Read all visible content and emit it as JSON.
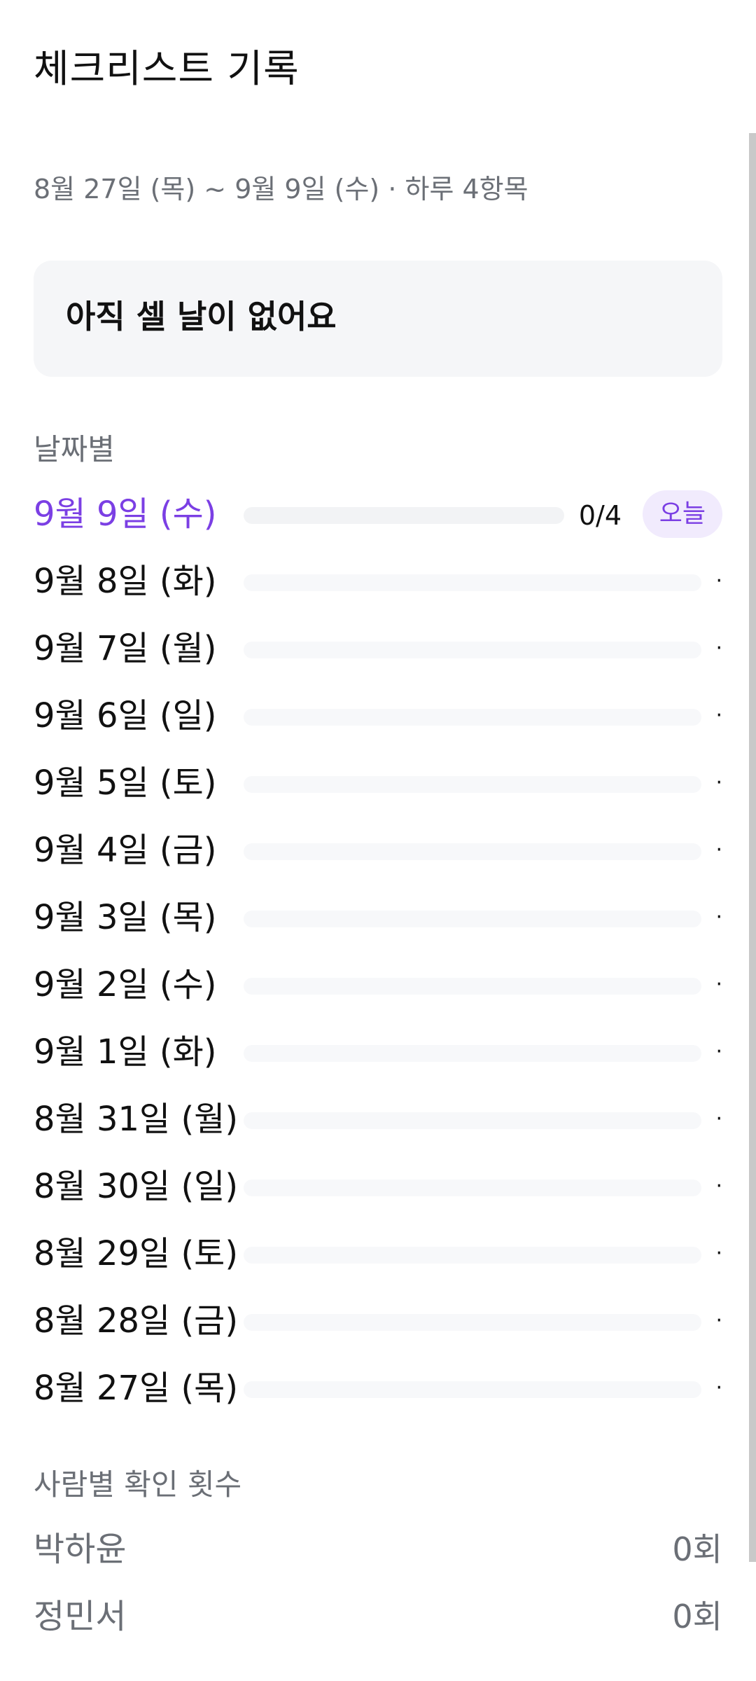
{
  "header": {
    "title": "체크리스트 기록"
  },
  "summary": "8월 27일 (목) ~ 9월 9일 (수) · 하루 4항목",
  "empty_state": {
    "message": "아직 셀 날이 없어요"
  },
  "by_date": {
    "label": "날짜별",
    "today_badge": "오늘",
    "dot_mark": "·",
    "rows": [
      {
        "label": "9월 9일 (수)",
        "today": true,
        "count": "0/4",
        "progress": 0
      },
      {
        "label": "9월 8일 (화)",
        "today": false,
        "progress": 0
      },
      {
        "label": "9월 7일 (월)",
        "today": false,
        "progress": 0
      },
      {
        "label": "9월 6일 (일)",
        "today": false,
        "progress": 0
      },
      {
        "label": "9월 5일 (토)",
        "today": false,
        "progress": 0
      },
      {
        "label": "9월 4일 (금)",
        "today": false,
        "progress": 0
      },
      {
        "label": "9월 3일 (목)",
        "today": false,
        "progress": 0
      },
      {
        "label": "9월 2일 (수)",
        "today": false,
        "progress": 0
      },
      {
        "label": "9월 1일 (화)",
        "today": false,
        "progress": 0
      },
      {
        "label": "8월 31일 (월)",
        "today": false,
        "progress": 0
      },
      {
        "label": "8월 30일 (일)",
        "today": false,
        "progress": 0
      },
      {
        "label": "8월 29일 (토)",
        "today": false,
        "progress": 0
      },
      {
        "label": "8월 28일 (금)",
        "today": false,
        "progress": 0
      },
      {
        "label": "8월 27일 (목)",
        "today": false,
        "progress": 0
      }
    ]
  },
  "by_person": {
    "label": "사람별 확인 횟수",
    "people": [
      {
        "name": "박하윤",
        "count": "0회"
      },
      {
        "name": "정민서",
        "count": "0회"
      }
    ]
  },
  "colors": {
    "accent": "#7b3fe4",
    "accent_soft": "#f1ebfd",
    "muted_text": "#6b6f76",
    "card_bg": "#f5f6f8"
  }
}
